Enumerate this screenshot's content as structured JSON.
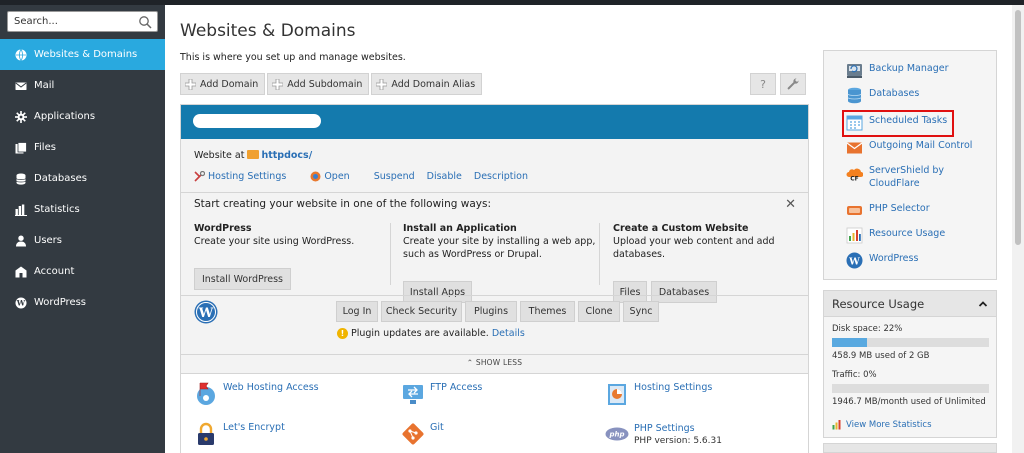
{
  "search": {
    "placeholder": "Search..."
  },
  "sidebar": {
    "items": [
      {
        "label": "Websites & Domains",
        "icon": "globe-icon",
        "active": true
      },
      {
        "label": "Mail",
        "icon": "mail-icon"
      },
      {
        "label": "Applications",
        "icon": "gear-icon"
      },
      {
        "label": "Files",
        "icon": "files-icon"
      },
      {
        "label": "Databases",
        "icon": "database-icon"
      },
      {
        "label": "Statistics",
        "icon": "bar-chart-icon"
      },
      {
        "label": "Users",
        "icon": "user-icon"
      },
      {
        "label": "Account",
        "icon": "account-icon"
      },
      {
        "label": "WordPress",
        "icon": "wordpress-icon"
      }
    ]
  },
  "page": {
    "title": "Websites & Domains",
    "subtitle": "This is where you set up and manage websites."
  },
  "toolbar": {
    "add_domain": "Add Domain",
    "add_subdomain": "Add Subdomain",
    "add_domain_alias": "Add Domain Alias",
    "help_icon": "?"
  },
  "domain": {
    "website_at": "Website at",
    "httpdocs": "httpdocs/",
    "actions": {
      "hosting_settings": "Hosting Settings",
      "open": "Open",
      "suspend": "Suspend",
      "disable": "Disable",
      "description": "Description"
    }
  },
  "start": {
    "title": "Start creating your website in one of the following ways:",
    "close": "✕",
    "wordpress": {
      "heading": "WordPress",
      "desc": "Create your site using WordPress.",
      "button": "Install WordPress"
    },
    "application": {
      "heading": "Install an Application",
      "desc1": "Create your site by installing a web app,",
      "desc2": "such as WordPress or Drupal.",
      "button": "Install Apps"
    },
    "custom": {
      "heading": "Create a Custom Website",
      "desc1": "Upload your web content and add",
      "desc2": "databases.",
      "button_files": "Files",
      "button_databases": "Databases"
    }
  },
  "wp": {
    "buttons": [
      "Log In",
      "Check Security",
      "Plugins",
      "Themes",
      "Clone",
      "Sync"
    ],
    "notice": "Plugin updates are available.",
    "details": "Details"
  },
  "show_less": "SHOW LESS",
  "tools": {
    "web_hosting_access": "Web Hosting Access",
    "ftp_access": "FTP Access",
    "hosting_settings": "Hosting Settings",
    "lets_encrypt": "Let's Encrypt",
    "git": "Git",
    "php_settings": "PHP Settings",
    "php_version": "PHP version: 5.6.31"
  },
  "right_links": {
    "backup_manager": "Backup Manager",
    "databases": "Databases",
    "scheduled_tasks": "Scheduled Tasks",
    "outgoing_mail": "Outgoing Mail Control",
    "servershield_1": "ServerShield by",
    "servershield_2": "CloudFlare",
    "php_selector": "PHP Selector",
    "resource_usage": "Resource Usage",
    "wordpress": "WordPress"
  },
  "resource_usage": {
    "title": "Resource Usage",
    "disk_label": "Disk space: 22%",
    "disk_percent": 22,
    "disk_detail": "458.9 MB used of 2 GB",
    "traffic_label": "Traffic: 0%",
    "traffic_percent": 0,
    "traffic_detail": "1946.7 MB/month used of Unlimited",
    "view_more": "View More Statistics"
  },
  "colors": {
    "sidebar_bg": "#333a41",
    "active_nav": "#29a9df",
    "domain_header": "#147aad",
    "link": "#2a6fb5",
    "highlight": "#e01010"
  }
}
